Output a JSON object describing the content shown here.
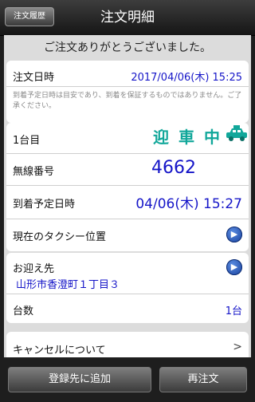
{
  "header": {
    "back_label": "注文履歴",
    "title": "注文明細"
  },
  "thanks": "ご注文ありがとうございました。",
  "order": {
    "datetime_label": "注文日時",
    "datetime_value": "2017/04/06(木) 15:25",
    "note": "到着予定日時は目安であり、到着を保証するものではありません。ご了承ください。"
  },
  "vehicle": {
    "index_label": "1台目",
    "status": "迎車中",
    "radio_label": "無線番号",
    "radio_value": "4662",
    "eta_label": "到着予定日時",
    "eta_value": "04/06(木) 15:27",
    "location_label": "現在のタクシー位置"
  },
  "pickup": {
    "label": "お迎え先",
    "address": "山形市香澄町１丁目３",
    "count_label": "台数",
    "count_value": "1台"
  },
  "cancel": {
    "label": "キャンセルについて",
    "chevron": ">"
  },
  "footer": {
    "add_label": "登録先に追加",
    "reorder_label": "再注文"
  },
  "colors": {
    "accent_blue": "#1515c8",
    "status_teal": "#11a79a"
  },
  "icons": {
    "taxi": "taxi-icon",
    "arrow": "arrow-right-icon"
  }
}
